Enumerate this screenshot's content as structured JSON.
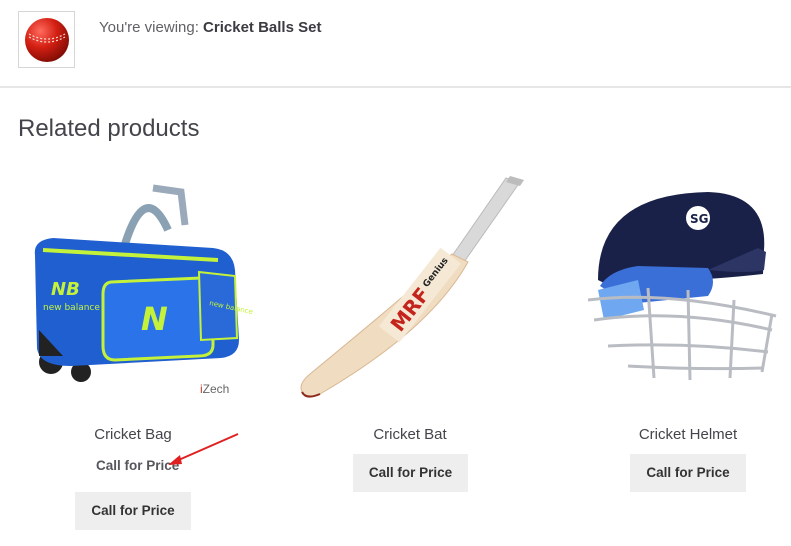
{
  "sticky": {
    "prefix": "You're viewing:",
    "product_name": "Cricket Balls Set",
    "thumb_icon": "cricket-ball-icon"
  },
  "related": {
    "title": "Related products",
    "products": [
      {
        "name": "Cricket Bag",
        "price_text": "Call for Price",
        "button_label": "Call for Price",
        "image_icon": "cricket-bag-image"
      },
      {
        "name": "Cricket Bat",
        "button_label": "Call for Price",
        "image_icon": "cricket-bat-image"
      },
      {
        "name": "Cricket Helmet",
        "button_label": "Call for Price",
        "image_icon": "cricket-helmet-image"
      }
    ]
  },
  "watermark": {
    "prefix": "i",
    "text": "Zech"
  },
  "colors": {
    "button_bg": "#eeeeee",
    "arrow": "#e02020",
    "divider": "#e6e6e6"
  }
}
